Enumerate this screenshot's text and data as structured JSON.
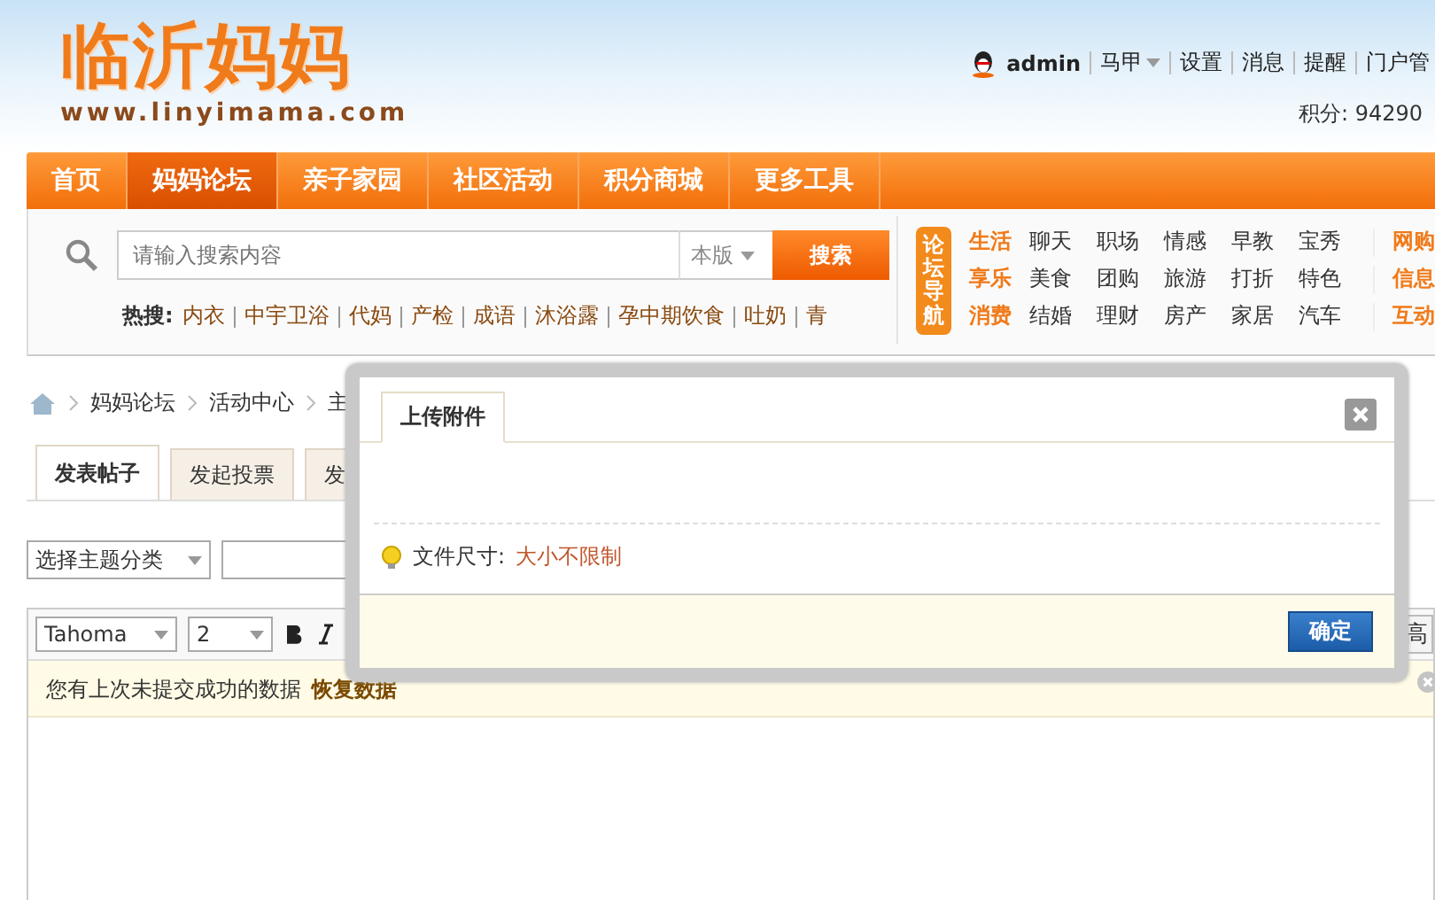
{
  "header": {
    "logo": {
      "title": "临沂妈妈",
      "url": "www.linyimama.com"
    },
    "user": {
      "name": "admin",
      "links": [
        {
          "label": "马甲",
          "dropdown": true
        },
        {
          "label": "设置",
          "dropdown": false
        },
        {
          "label": "消息",
          "dropdown": false
        },
        {
          "label": "提醒",
          "dropdown": false
        },
        {
          "label": "门户管",
          "dropdown": false
        }
      ],
      "points": "积分: 94290"
    }
  },
  "nav": [
    {
      "label": "首页",
      "selected": false
    },
    {
      "label": "妈妈论坛",
      "selected": true
    },
    {
      "label": "亲子家园",
      "selected": false
    },
    {
      "label": "社区活动",
      "selected": false
    },
    {
      "label": "积分商城",
      "selected": false
    },
    {
      "label": "更多工具",
      "selected": false
    }
  ],
  "search": {
    "placeholder": "请输入搜索内容",
    "scope": "本版",
    "button": "搜索",
    "hot_label": "热搜:",
    "hot": [
      "内衣",
      "中宇卫浴",
      "代妈",
      "产检",
      "成语",
      "沐浴露",
      "孕中期饮食",
      "吐奶",
      "青"
    ]
  },
  "forum_nav": {
    "tag": "论坛导航",
    "rows": [
      {
        "category": "生活",
        "links": [
          "聊天",
          "职场",
          "情感",
          "早教",
          "宝秀"
        ],
        "extra": "网购"
      },
      {
        "category": "享乐",
        "links": [
          "美食",
          "团购",
          "旅游",
          "打折",
          "特色"
        ],
        "extra": "信息"
      },
      {
        "category": "消费",
        "links": [
          "结婚",
          "理财",
          "房产",
          "家居",
          "汽车"
        ],
        "extra": "互动"
      }
    ]
  },
  "breadcrumb": [
    "妈妈论坛",
    "活动中心",
    "主"
  ],
  "tabs": [
    {
      "label": "发表帖子",
      "selected": true
    },
    {
      "label": "发起投票",
      "selected": false
    },
    {
      "label": "发",
      "selected": false
    }
  ],
  "category_select": "选择主题分类",
  "editor": {
    "font": "Tahoma",
    "size": "2",
    "advanced": "高",
    "notice": "您有上次未提交成功的数据",
    "restore": "恢复数据"
  },
  "dialog": {
    "title": "上传附件",
    "tip_label": "文件尺寸:",
    "tip_value": "大小不限制",
    "button": "确定"
  }
}
